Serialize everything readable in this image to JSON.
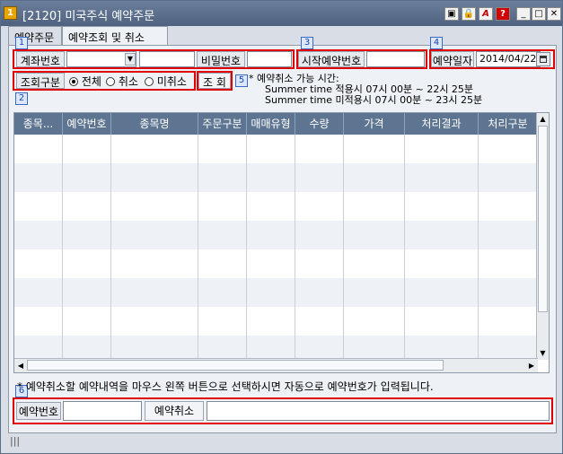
{
  "window": {
    "app_badge": "1",
    "title": "[2120] 미국주식 예약주문",
    "buttons": {
      "screen": "▣",
      "lock": "🔒",
      "text": "A",
      "help": "?",
      "minimize": "_",
      "maximize": "□",
      "close": "✕"
    }
  },
  "tabs": [
    {
      "label": "예약주문",
      "active": false
    },
    {
      "label": "예약조회 및 취소",
      "active": true
    }
  ],
  "markers": [
    "1",
    "2",
    "3",
    "4",
    "5",
    "6"
  ],
  "search": {
    "account_label": "계좌번호",
    "account_value": "",
    "account_name_value": "",
    "password_label": "비밀번호",
    "password_value": "",
    "start_no_label": "시작예약번호",
    "start_no_value": "",
    "date_label": "예약일자",
    "date_value": "2014/04/22",
    "filter_label": "조회구분",
    "filter_options": [
      {
        "label": "전체",
        "selected": true
      },
      {
        "label": "취소",
        "selected": false
      },
      {
        "label": "미취소",
        "selected": false
      }
    ],
    "query_button": "조 회"
  },
  "notice": {
    "line1": "* 예약취소 가능 시간:",
    "line2": "Summer time 적용시   07시 00분 ~ 22시 25분",
    "line3": "Summer time 미적용시 07시 00분 ~ 23시 25분"
  },
  "table": {
    "columns": [
      "종목...",
      "예약번호",
      "종목명",
      "주문구분",
      "매매유형",
      "수량",
      "가격",
      "처리결과",
      "처리구분"
    ]
  },
  "hint": "* 예약취소할 예약내역을 마우스 왼쪽 버튼으로 선택하시면 자동으로 예약번호가 입력됩니다.",
  "cancel": {
    "no_label": "예약번호",
    "no_value": "",
    "cancel_button": "예약취소",
    "message": ""
  },
  "status": {
    "grip": "|||"
  }
}
